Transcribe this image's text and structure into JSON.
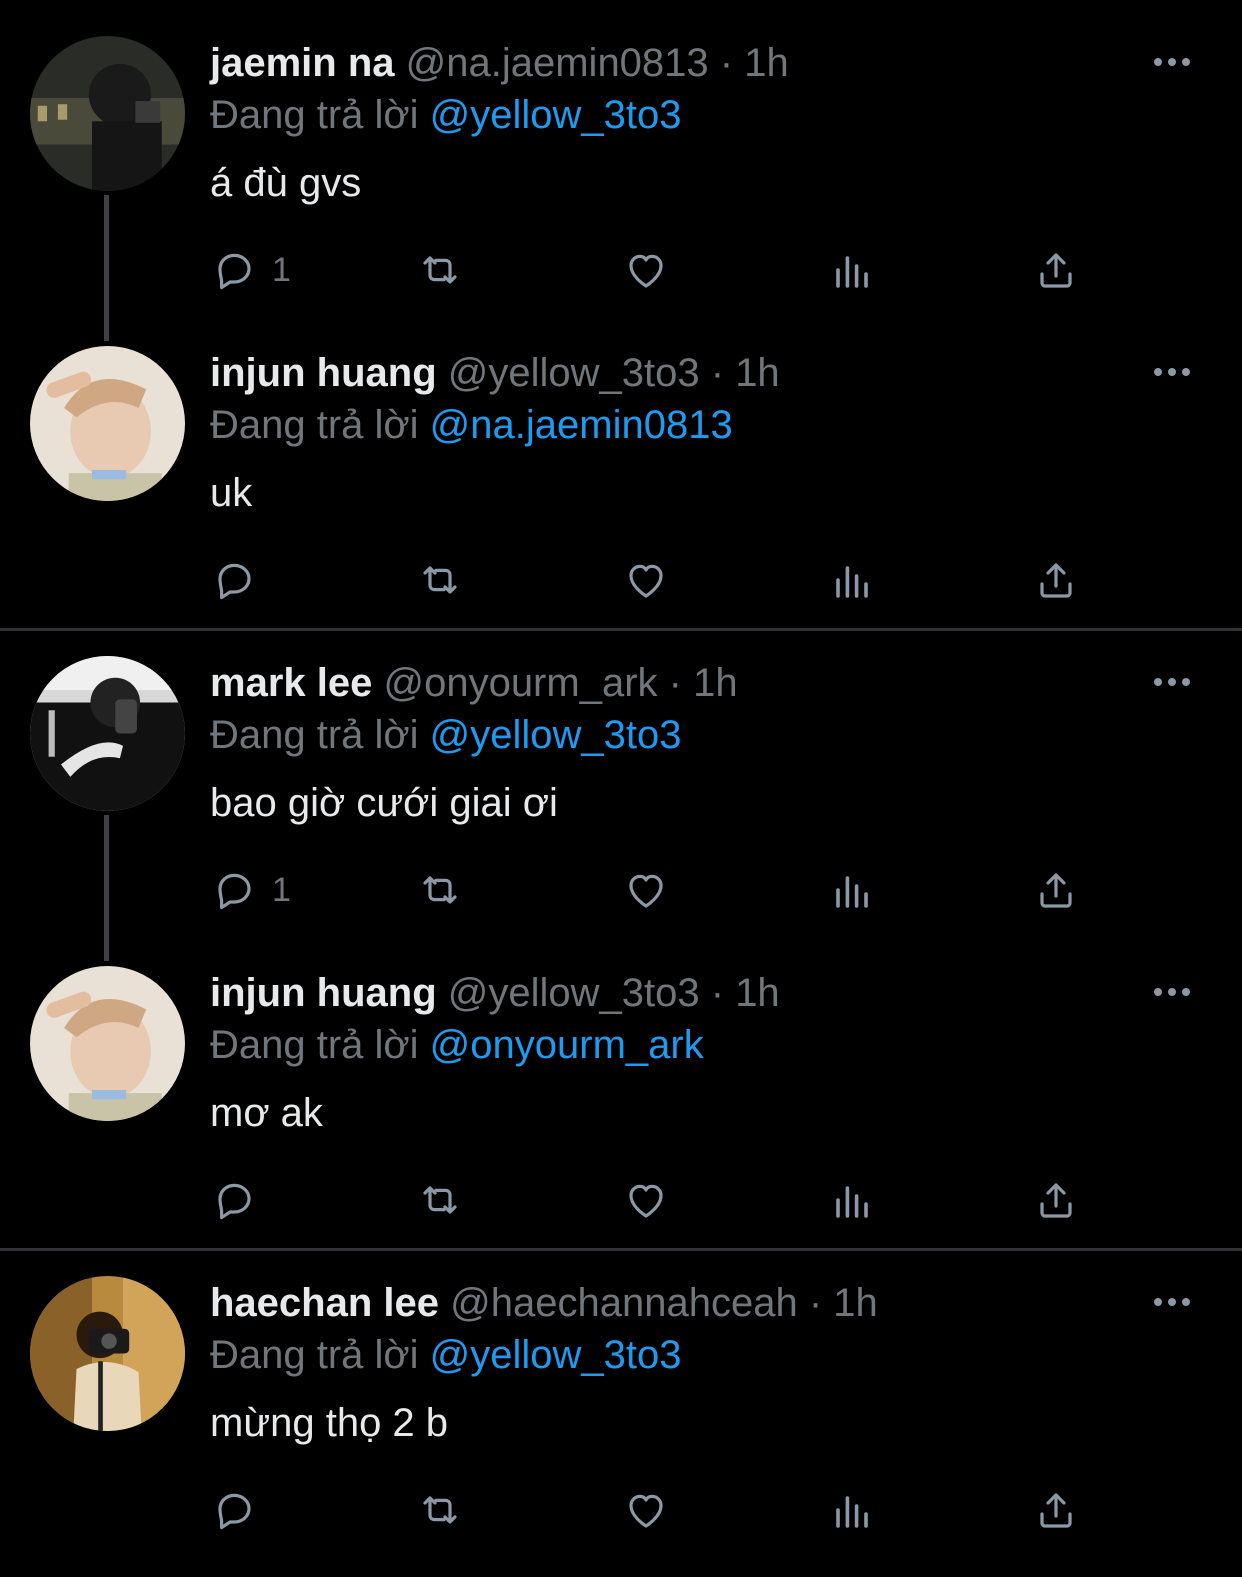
{
  "colors": {
    "background": "#000000",
    "text": "#e7e9ea",
    "muted": "#71767b",
    "accent": "#1d9bf0"
  },
  "reply_prefix": "Đang trả lời",
  "separator": "·",
  "icons": [
    "reply-icon",
    "retweet-icon",
    "like-icon",
    "views-icon",
    "share-icon",
    "more-icon"
  ],
  "tweets": [
    {
      "name": "jaemin na",
      "handle": "@na.jaemin0813",
      "time": "1h",
      "replying_to": "@yellow_3to3",
      "text": "á đù gvs",
      "reply_count": "1"
    },
    {
      "name": "injun huang",
      "handle": "@yellow_3to3",
      "time": "1h",
      "replying_to": "@na.jaemin0813",
      "text": "uk",
      "reply_count": ""
    },
    {
      "name": "mark lee",
      "handle": "@onyourm_ark",
      "time": "1h",
      "replying_to": "@yellow_3to3",
      "text": "bao giờ cưới giai ơi",
      "reply_count": "1"
    },
    {
      "name": "injun huang",
      "handle": "@yellow_3to3",
      "time": "1h",
      "replying_to": "@onyourm_ark",
      "text": "mơ ak",
      "reply_count": ""
    },
    {
      "name": "haechan lee",
      "handle": "@haechannahceah",
      "time": "1h",
      "replying_to": "@yellow_3to3",
      "text": "mừng thọ 2 b",
      "reply_count": ""
    }
  ]
}
